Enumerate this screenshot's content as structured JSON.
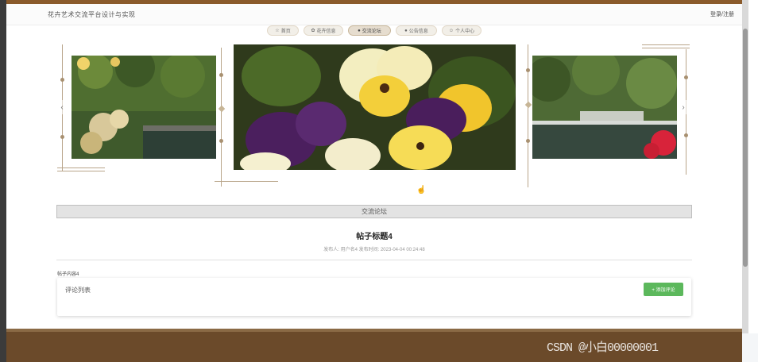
{
  "header": {
    "site_title": "花卉艺术交流平台设计与实现",
    "login_link": "登录/注册"
  },
  "nav": {
    "items": [
      {
        "label": "首页",
        "icon": "home-icon",
        "glyph": "☆"
      },
      {
        "label": "花卉信息",
        "icon": "flower-icon",
        "glyph": "✿"
      },
      {
        "label": "交流论坛",
        "icon": "forum-icon",
        "glyph": "●",
        "active": true
      },
      {
        "label": "公告信息",
        "icon": "notice-icon",
        "glyph": "●"
      },
      {
        "label": "个人中心",
        "icon": "user-icon",
        "glyph": "☺"
      }
    ]
  },
  "carousel": {
    "prev_glyph": "‹",
    "next_glyph": "›"
  },
  "section": {
    "title": "交流论坛"
  },
  "post": {
    "title": "帖子标题4",
    "meta": "发布人: 用户名4  发布时间: 2023-04-04 00:24:48",
    "content_label": "帖子内容4"
  },
  "comments": {
    "heading": "评论列表",
    "add_button": "+ 添加评论"
  },
  "footer": {
    "watermark": "CSDN @小白00000001"
  },
  "colors": {
    "topline": "#8a5a2b",
    "footer": "#6b4a2a",
    "accent_green": "#5cb85c"
  }
}
